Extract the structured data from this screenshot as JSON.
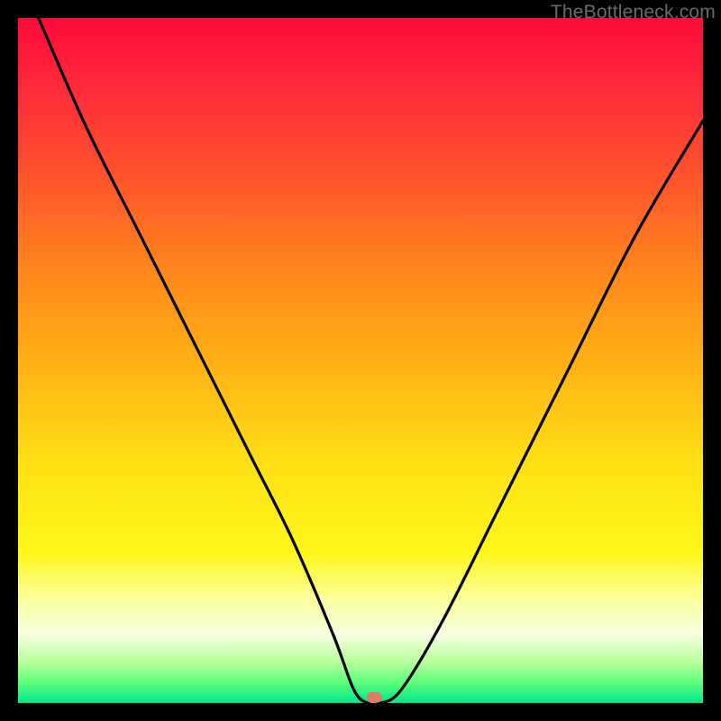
{
  "watermark": "TheBottleneck.com",
  "chart_data": {
    "type": "line",
    "title": "",
    "xlabel": "",
    "ylabel": "",
    "xlim": [
      0,
      100
    ],
    "ylim": [
      0,
      100
    ],
    "gradient_meaning": "bottleneck severity (red = high bottleneck, green = balanced)",
    "series": [
      {
        "name": "bottleneck-curve",
        "x": [
          3,
          10,
          18,
          26,
          34,
          40,
          46,
          49,
          51,
          53,
          56,
          62,
          70,
          80,
          90,
          100
        ],
        "values": [
          100,
          84,
          68,
          52,
          36,
          24,
          10,
          2,
          0,
          0,
          2,
          12,
          28,
          48,
          68,
          85
        ]
      }
    ],
    "marker": {
      "x": 52,
      "y": 0.8,
      "label": "optimal-point"
    },
    "gradient_stops": [
      {
        "pos": 0,
        "color": "#ff0a3a"
      },
      {
        "pos": 10,
        "color": "#ff2a3a"
      },
      {
        "pos": 25,
        "color": "#ff5a2a"
      },
      {
        "pos": 38,
        "color": "#ff8a1a"
      },
      {
        "pos": 50,
        "color": "#ffb015"
      },
      {
        "pos": 65,
        "color": "#ffe015"
      },
      {
        "pos": 78,
        "color": "#fff71a"
      },
      {
        "pos": 85,
        "color": "#fbffa0"
      },
      {
        "pos": 90,
        "color": "#f6ffe0"
      },
      {
        "pos": 94,
        "color": "#b8ff9c"
      },
      {
        "pos": 97,
        "color": "#5dff7a"
      },
      {
        "pos": 100,
        "color": "#00e88a"
      }
    ]
  }
}
